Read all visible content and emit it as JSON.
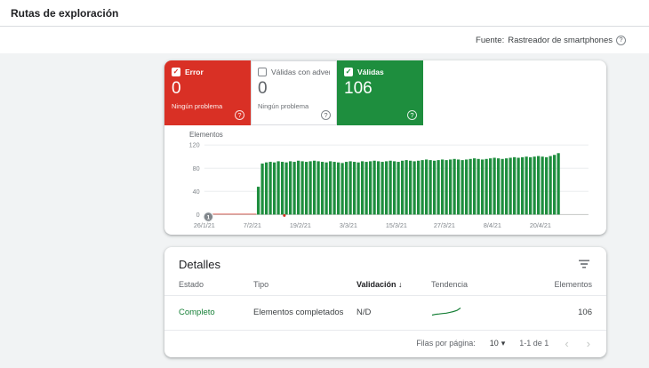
{
  "page": {
    "title": "Rutas de exploración"
  },
  "source": {
    "label": "Fuente:",
    "value": "Rastreador de smartphones"
  },
  "icons": {
    "help": "?",
    "check": "✓",
    "sort_desc": "↓",
    "dropdown_arrow": "▾",
    "prev": "‹",
    "next": "›"
  },
  "summary": {
    "error": {
      "label": "Error",
      "value": "0",
      "subtext": "Ningún problema",
      "checked": true,
      "color": "#d93025"
    },
    "valid_warn": {
      "label": "Válidas con adver...",
      "value": "0",
      "subtext": "Ningún problema",
      "checked": false
    },
    "valid": {
      "label": "Válidas",
      "value": "106",
      "checked": true,
      "color": "#1e8e3e"
    }
  },
  "chart_data": {
    "type": "bar",
    "ylabel": "Elementos",
    "ylim": [
      0,
      120
    ],
    "yticks": [
      0,
      40,
      80,
      120
    ],
    "total_days": 96,
    "start_day": 13,
    "bar_color": "#1e8e3e",
    "error_color": "#d93025",
    "marker_day": 1,
    "marker_label": "1",
    "error_dot_day": 20,
    "x_ticks": [
      {
        "day": 0,
        "label": "26/1/21"
      },
      {
        "day": 12,
        "label": "7/2/21"
      },
      {
        "day": 24,
        "label": "19/2/21"
      },
      {
        "day": 36,
        "label": "3/3/21"
      },
      {
        "day": 48,
        "label": "15/3/21"
      },
      {
        "day": 60,
        "label": "27/3/21"
      },
      {
        "day": 72,
        "label": "8/4/21"
      },
      {
        "day": 84,
        "label": "20/4/21"
      }
    ],
    "series": [
      {
        "name": "Válidas",
        "values": [
          48,
          88,
          90,
          91,
          90,
          92,
          91,
          90,
          92,
          91,
          93,
          92,
          91,
          92,
          93,
          92,
          91,
          90,
          92,
          91,
          90,
          89,
          91,
          92,
          91,
          90,
          92,
          91,
          92,
          93,
          92,
          91,
          92,
          93,
          92,
          91,
          93,
          94,
          93,
          92,
          93,
          94,
          95,
          94,
          93,
          94,
          95,
          94,
          95,
          96,
          95,
          94,
          95,
          96,
          97,
          96,
          95,
          96,
          97,
          98,
          97,
          96,
          97,
          98,
          99,
          98,
          99,
          100,
          99,
          100,
          101,
          100,
          99,
          101,
          103,
          106
        ]
      }
    ]
  },
  "details": {
    "title": "Detalles",
    "columns": {
      "estado": "Estado",
      "tipo": "Tipo",
      "validacion": "Validación",
      "tendencia": "Tendencia",
      "elementos": "Elementos"
    },
    "row": {
      "estado": "Completo",
      "tipo": "Elementos completados",
      "validacion": "N/D",
      "elementos": "106",
      "trend": [
        88,
        90,
        91,
        92,
        93,
        95,
        97,
        100,
        106
      ]
    },
    "pagination": {
      "label": "Filas por página:",
      "value": "10",
      "range": "1-1 de 1"
    }
  }
}
